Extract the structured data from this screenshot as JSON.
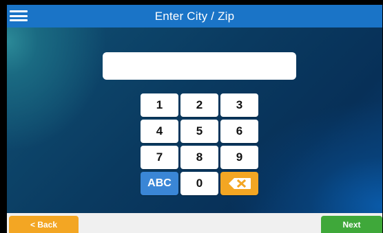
{
  "header": {
    "title": "Enter City / Zip"
  },
  "search": {
    "value": "",
    "placeholder": ""
  },
  "keypad": {
    "keys": [
      "1",
      "2",
      "3",
      "4",
      "5",
      "6",
      "7",
      "8",
      "9",
      "ABC",
      "0"
    ],
    "backspace_icon": "backspace-icon"
  },
  "footer": {
    "back_label": "< Back",
    "next_label": "Next"
  },
  "colors": {
    "header": "#1a74c7",
    "abc_key": "#3a86d6",
    "backspace_key": "#f3a623",
    "back_button": "#f3a623",
    "next_button": "#3fa83a"
  }
}
